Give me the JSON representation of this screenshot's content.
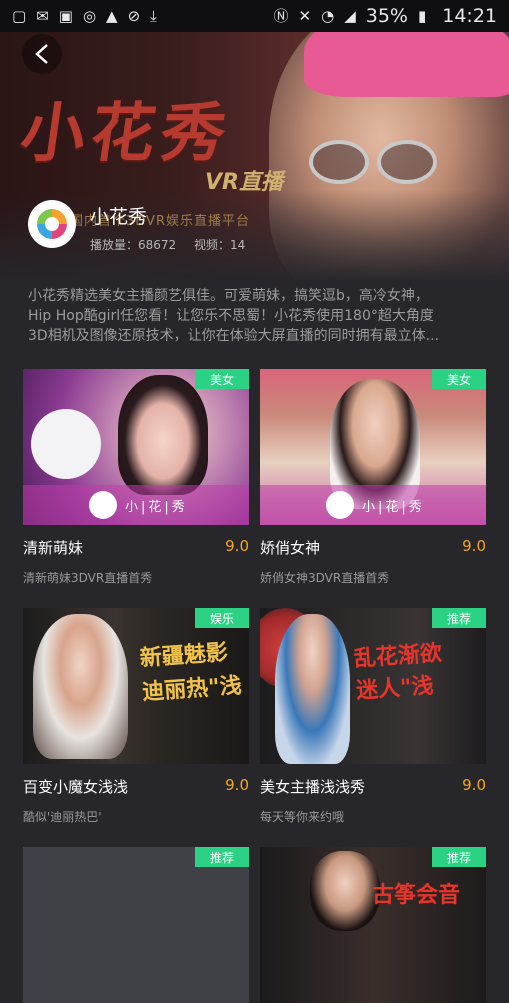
{
  "status_bar": {
    "battery": "35%",
    "time": "14:21",
    "left_icons": [
      "sim-icon",
      "message-icon",
      "image-icon",
      "sync-icon",
      "warning-icon",
      "blocked-icon",
      "download-icon"
    ],
    "right_icons": [
      "nfc-icon",
      "mute-icon",
      "wifi-icon",
      "signal-icon",
      "battery-icon"
    ]
  },
  "hero": {
    "title_art": "小花秀",
    "subtitle_art": "VR直播",
    "tagline": "国内首个3DVR娱乐直播平台"
  },
  "channel": {
    "name": "小花秀",
    "views_label": "播放量：68672",
    "videos_label": "视频：14"
  },
  "description": {
    "line1": "小花秀精选美女主播颜艺俱佳。可爱萌妹，搞笑逗b，高冷女神，",
    "line2": "Hip Hop酷girl任您看！让您乐不思蜀！小花秀使用180°超大角度",
    "line3": "3D相机及图像还原技术，让你在体验大屏直播的同时拥有最立体..."
  },
  "cards": [
    {
      "tag": "美女",
      "title": "清新萌妹",
      "score": "9.0",
      "subtitle": "清新萌妹3DVR直播首秀",
      "logo_text": "小|花|秀",
      "art_text": ""
    },
    {
      "tag": "美女",
      "title": "娇俏女神",
      "score": "9.0",
      "subtitle": "娇俏女神3DVR直播首秀",
      "logo_text": "小|花|秀",
      "art_text": ""
    },
    {
      "tag": "娱乐",
      "title": "百变小魔女浅浅",
      "score": "9.0",
      "subtitle": "酷似'迪丽热巴'",
      "art_text": "新疆魅影\n迪丽热\"浅",
      "logo_text": ""
    },
    {
      "tag": "推荐",
      "title": "美女主播浅浅秀",
      "score": "9.0",
      "subtitle": "每天等你来约哦",
      "art_text": "乱花渐欲\n迷人\"浅",
      "logo_text": ""
    },
    {
      "tag": "推荐",
      "title": "",
      "score": "",
      "subtitle": "",
      "art_text": "",
      "logo_text": ""
    },
    {
      "tag": "推荐",
      "title": "",
      "score": "",
      "subtitle": "",
      "art_text": "古筝会音",
      "logo_text": ""
    }
  ],
  "colors": {
    "tag_green": "#2bd284",
    "score_orange": "#f5a623",
    "background": "#26262b"
  }
}
